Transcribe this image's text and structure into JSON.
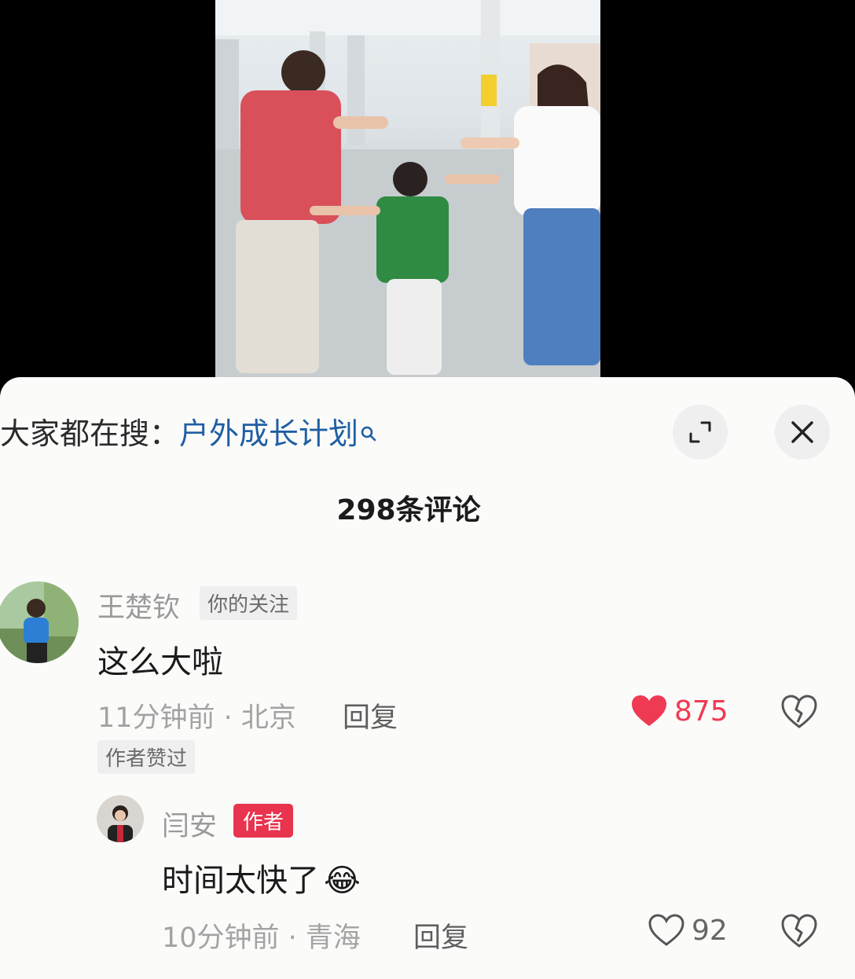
{
  "search": {
    "prefix": "大家都在搜：",
    "term": "户外成长计划",
    "icon": "search-icon"
  },
  "controls": {
    "expand_icon": "expand-icon",
    "close_icon": "close-icon"
  },
  "comment_count": "298条评论",
  "comments": [
    {
      "username": "王楚钦",
      "tag": "你的关注",
      "content": "这么大啦",
      "meta": "11分钟前 · 北京",
      "reply": "回复",
      "likes": "875",
      "liked": true,
      "badge": "作者赞过",
      "replies": [
        {
          "username": "闫安",
          "tag": "作者",
          "content": "时间太快了",
          "emoji": "😂",
          "meta": "10分钟前 · 青海",
          "reply": "回复",
          "likes": "92",
          "liked": false
        }
      ]
    }
  ],
  "colors": {
    "sheet_bg": "#fbfbfa",
    "link_blue": "#1f5fa3",
    "like_red": "#ef3a53",
    "author_tag": "#e8344e"
  }
}
